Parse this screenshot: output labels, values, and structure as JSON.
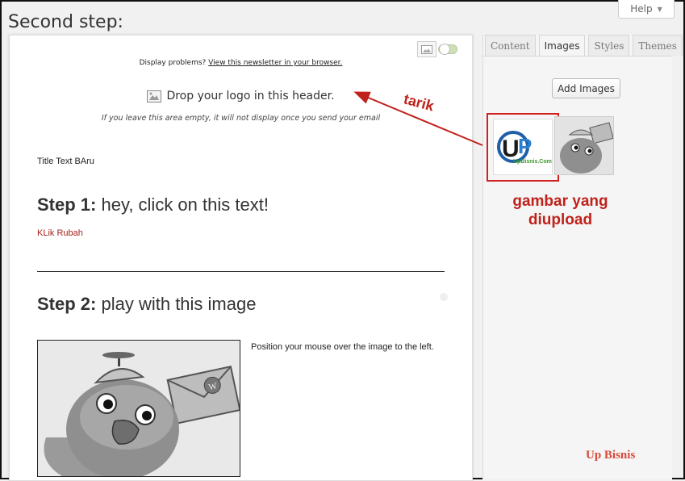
{
  "header": {
    "title": "Second step:",
    "help_label": "Help"
  },
  "editor": {
    "display_problems": "Display problems?",
    "view_link": "View this newsletter in your browser.",
    "logo_drop": "Drop your logo in this header.",
    "logo_note": "If you leave this area empty, it will not display once you send your email",
    "title_text": "Title Text BAru",
    "step1_label": "Step 1:",
    "step1_text": "hey, click on this text!",
    "klik_rubah": "KLik Rubah",
    "step2_label": "Step 2:",
    "step2_text": "play with this image",
    "position_text": "Position your mouse over the image to the left."
  },
  "panel": {
    "tabs": [
      {
        "label": "Content",
        "active": false
      },
      {
        "label": "Images",
        "active": true
      },
      {
        "label": "Styles",
        "active": false
      },
      {
        "label": "Themes",
        "active": false
      }
    ],
    "add_images_label": "Add Images",
    "thumb1_brand": "UpBisnis.Com"
  },
  "annotations": {
    "tarik": "tarik",
    "gambar_line1": "gambar yang",
    "gambar_line2": "diupload",
    "watermark": "Up Bisnis"
  },
  "colors": {
    "annotation_red": "#c0221b",
    "link_red": "#a5221b"
  }
}
